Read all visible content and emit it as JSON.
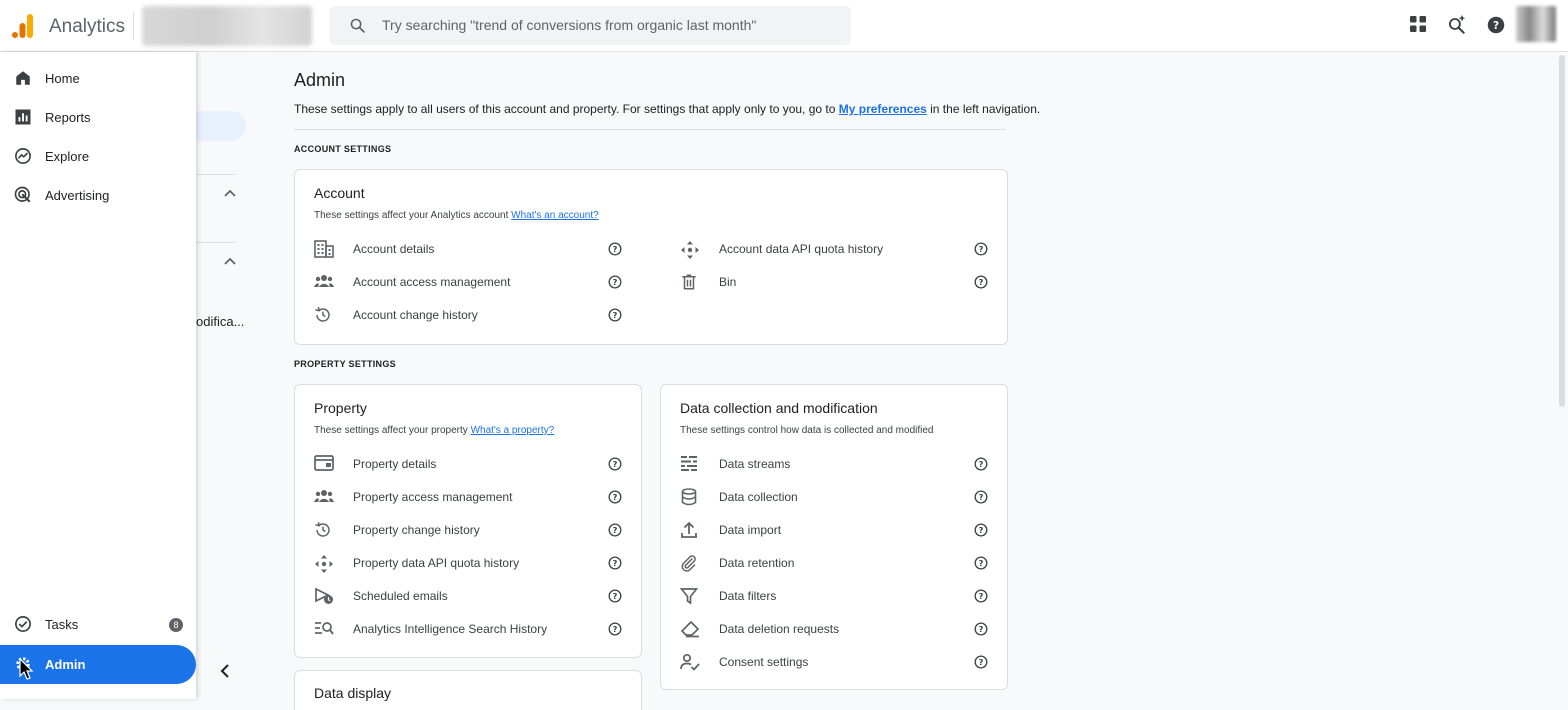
{
  "colors": {
    "accent": "#1a73e8",
    "logo_orange": "#f9ab00",
    "logo_dark": "#e37400"
  },
  "header": {
    "app_title": "Analytics",
    "search_placeholder": "Try searching \"trend of conversions from organic last month\"",
    "icons": [
      "apps-grid-icon",
      "search-insights-icon",
      "help-icon",
      "user-avatar"
    ]
  },
  "nav": {
    "items": [
      {
        "label": "Home",
        "icon": "home-icon"
      },
      {
        "label": "Reports",
        "icon": "bar-chart-icon"
      },
      {
        "label": "Explore",
        "icon": "explore-icon"
      },
      {
        "label": "Advertising",
        "icon": "advertising-icon"
      }
    ],
    "tasks": {
      "label": "Tasks",
      "badge": "8"
    },
    "admin": {
      "label": "Admin"
    }
  },
  "subnav": {
    "truncated_text": "odifica..."
  },
  "main": {
    "title": "Admin",
    "intro_prefix": "These settings apply to all users of this account and property. For settings that apply only to you, go to ",
    "intro_link": "My preferences",
    "intro_suffix": " in the left navigation.",
    "account_section": "ACCOUNT SETTINGS",
    "property_section": "PROPERTY SETTINGS"
  },
  "account_card": {
    "title": "Account",
    "desc": "These settings affect your Analytics account ",
    "desc_link": "What's an account?",
    "items_left": [
      {
        "label": "Account details",
        "icon": "building-icon"
      },
      {
        "label": "Account access management",
        "icon": "people-icon"
      },
      {
        "label": "Account change history",
        "icon": "history-icon"
      }
    ],
    "items_right": [
      {
        "label": "Account data API quota history",
        "icon": "api-quota-icon"
      },
      {
        "label": "Bin",
        "icon": "trash-icon"
      }
    ]
  },
  "property_card": {
    "title": "Property",
    "desc": "These settings affect your property ",
    "desc_link": "What's a property?",
    "items": [
      {
        "label": "Property details",
        "icon": "property-card-icon"
      },
      {
        "label": "Property access management",
        "icon": "people-icon"
      },
      {
        "label": "Property change history",
        "icon": "history-icon"
      },
      {
        "label": "Property data API quota history",
        "icon": "api-quota-icon"
      },
      {
        "label": "Scheduled emails",
        "icon": "scheduled-send-icon"
      },
      {
        "label": "Analytics Intelligence Search History",
        "icon": "search-history-icon"
      }
    ]
  },
  "data_card": {
    "title": "Data collection and modification",
    "desc": "These settings control how data is collected and modified",
    "items": [
      {
        "label": "Data streams",
        "icon": "data-streams-icon"
      },
      {
        "label": "Data collection",
        "icon": "database-icon"
      },
      {
        "label": "Data import",
        "icon": "upload-icon"
      },
      {
        "label": "Data retention",
        "icon": "paperclip-icon"
      },
      {
        "label": "Data filters",
        "icon": "filter-icon"
      },
      {
        "label": "Data deletion requests",
        "icon": "eraser-icon"
      },
      {
        "label": "Consent settings",
        "icon": "consent-icon"
      }
    ]
  },
  "display_card": {
    "title": "Data display"
  }
}
